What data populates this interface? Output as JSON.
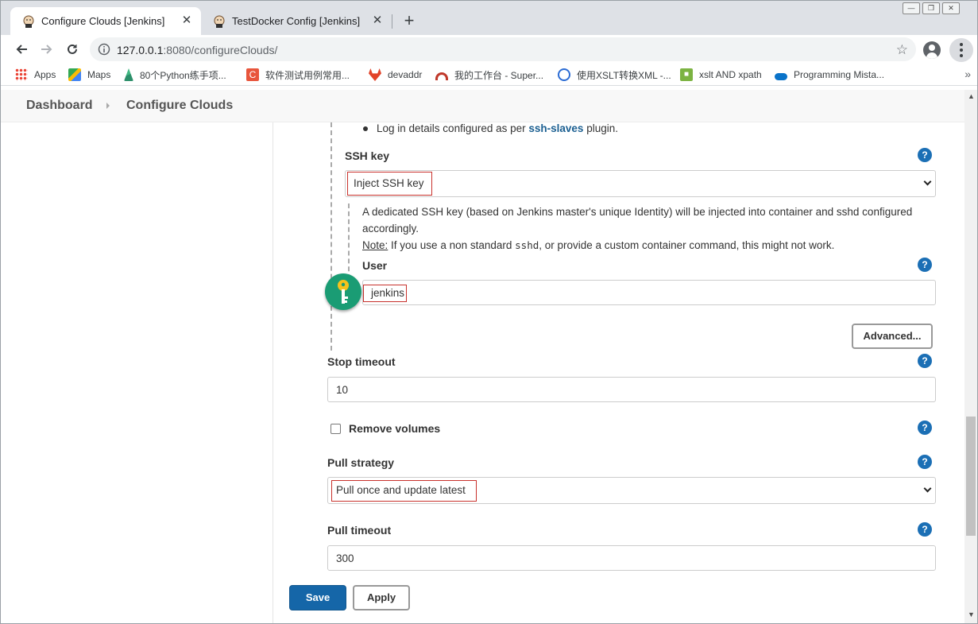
{
  "browser": {
    "tabs": [
      {
        "title": "Configure Clouds [Jenkins]",
        "active": true
      },
      {
        "title": "TestDocker Config [Jenkins]",
        "active": false
      }
    ],
    "new_tab_label": "+",
    "close_glyph": "✕",
    "url_host": "127.0.0.1",
    "url_rest": ":8080/configureClouds/",
    "bookmarks": [
      {
        "label": "Apps",
        "icon": "apps-grid-icon"
      },
      {
        "label": "Maps",
        "icon": "maps-icon"
      },
      {
        "label": "80个Python练手项...",
        "icon": "python-project-icon"
      },
      {
        "label": "软件测试用例常用...",
        "icon": "testing-icon"
      },
      {
        "label": "devaddr",
        "icon": "gitlab-icon"
      },
      {
        "label": "我的工作台 - Super...",
        "icon": "workbench-icon"
      },
      {
        "label": "使用XSLT转换XML -...",
        "icon": "xslt-icon"
      },
      {
        "label": "xslt AND xpath",
        "icon": "xpath-icon"
      },
      {
        "label": "Programming Mista...",
        "icon": "cloud-icon"
      }
    ],
    "bookmarks_more": "»"
  },
  "breadcrumb": {
    "items": [
      "Dashboard",
      "Configure Clouds"
    ]
  },
  "form": {
    "login_note_prefix": "Log in details configured as per ",
    "login_note_link": "ssh-slaves",
    "login_note_suffix": " plugin.",
    "ssh_key": {
      "label": "SSH key",
      "value": "Inject SSH key",
      "description": "A dedicated SSH key (based on Jenkins master's unique Identity) will be injected into container and sshd configured accordingly.",
      "note_label": "Note:",
      "note_text_1": " If you use a non standard ",
      "note_code": "sshd",
      "note_text_2": ", or provide a custom container command, this might not work."
    },
    "user": {
      "label": "User",
      "value": "jenkins"
    },
    "advanced_label": "Advanced...",
    "stop_timeout": {
      "label": "Stop timeout",
      "value": "10"
    },
    "remove_volumes": {
      "label": "Remove volumes",
      "checked": false
    },
    "pull_strategy": {
      "label": "Pull strategy",
      "value": "Pull once and update latest"
    },
    "pull_timeout": {
      "label": "Pull timeout",
      "value": "300"
    },
    "help_glyph": "?"
  },
  "actions": {
    "save_label": "Save",
    "apply_label": "Apply"
  },
  "colors": {
    "primary_button": "#1566a8",
    "help_icon": "#1b6fb5",
    "highlight_box": "#c8312c",
    "key_badge": "#1a9c74",
    "link": "#1b5f91"
  }
}
